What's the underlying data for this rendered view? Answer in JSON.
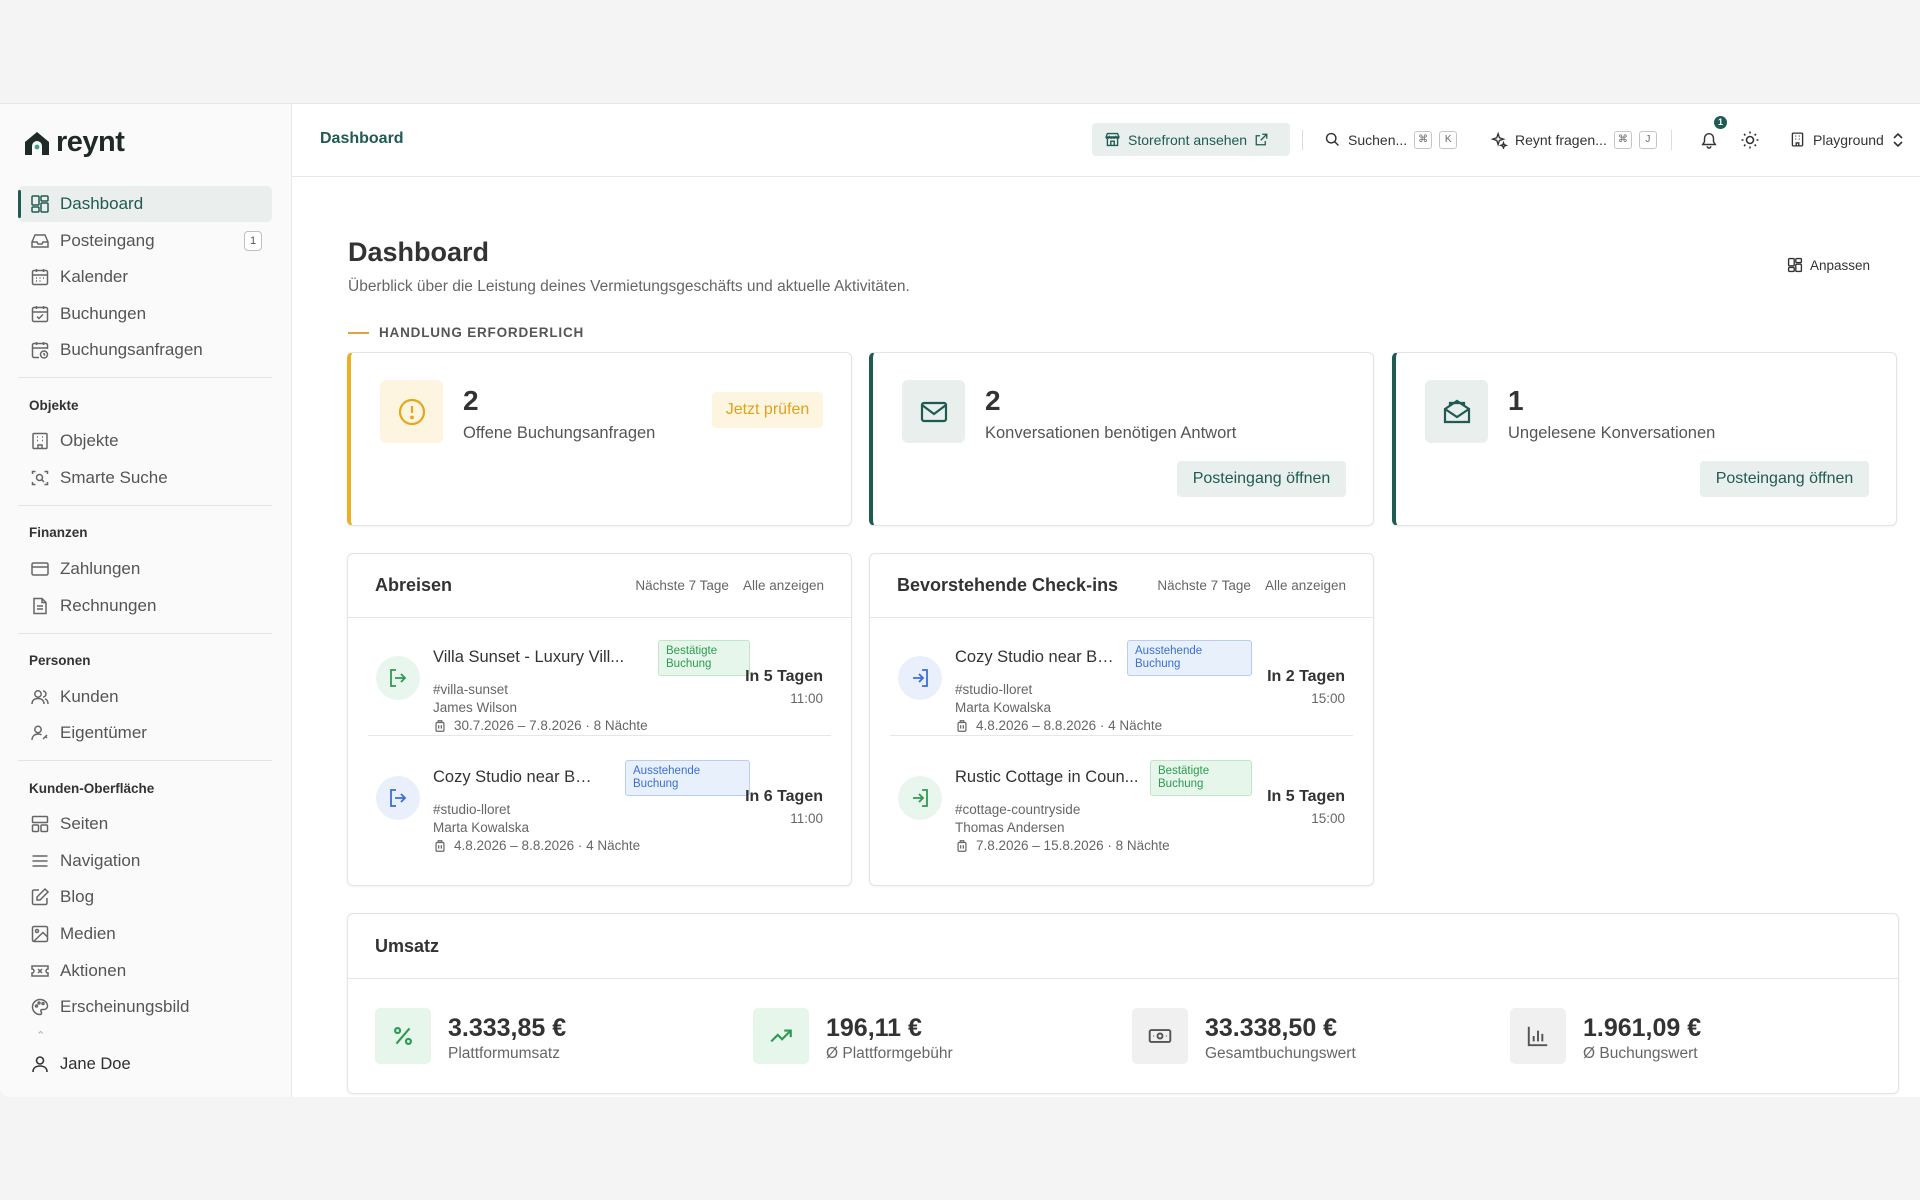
{
  "brand": {
    "name": "reynt",
    "accent": "#1f5b52"
  },
  "sidebar": {
    "items_top": [
      {
        "label": "Dashboard",
        "icon": "dashboard-icon",
        "active": true
      },
      {
        "label": "Posteingang",
        "icon": "inbox-icon",
        "badge": "1"
      },
      {
        "label": "Kalender",
        "icon": "calendar-icon"
      },
      {
        "label": "Buchungen",
        "icon": "calendar-check-icon"
      },
      {
        "label": "Buchungsanfragen",
        "icon": "calendar-clock-icon"
      }
    ],
    "sections": [
      {
        "title": "Objekte",
        "items": [
          {
            "label": "Objekte",
            "icon": "building-icon"
          },
          {
            "label": "Smarte Suche",
            "icon": "scan-search-icon"
          }
        ]
      },
      {
        "title": "Finanzen",
        "items": [
          {
            "label": "Zahlungen",
            "icon": "credit-card-icon"
          },
          {
            "label": "Rechnungen",
            "icon": "file-text-icon"
          }
        ]
      },
      {
        "title": "Personen",
        "items": [
          {
            "label": "Kunden",
            "icon": "users-icon"
          },
          {
            "label": "Eigentümer",
            "icon": "user-key-icon"
          }
        ]
      },
      {
        "title": "Kunden-Oberfläche",
        "items": [
          {
            "label": "Seiten",
            "icon": "layout-icon"
          },
          {
            "label": "Navigation",
            "icon": "menu-icon"
          },
          {
            "label": "Blog",
            "icon": "edit-icon"
          },
          {
            "label": "Medien",
            "icon": "image-icon"
          },
          {
            "label": "Aktionen",
            "icon": "ticket-icon"
          },
          {
            "label": "Erscheinungsbild",
            "icon": "palette-icon"
          }
        ]
      }
    ],
    "user": "Jane Doe"
  },
  "topbar": {
    "breadcrumb": "Dashboard",
    "storefront": "Storefront ansehen",
    "search": "Suchen...",
    "search_keys": [
      "⌘",
      "K"
    ],
    "ask": "Reynt fragen...",
    "ask_keys": [
      "⌘",
      "J"
    ],
    "notif_count": "1",
    "workspace": "Playground"
  },
  "page": {
    "title": "Dashboard",
    "subtitle": "Überblick über die Leistung deines Vermietungsgeschäfts und aktuelle Aktivitäten.",
    "customize": "Anpassen",
    "section_label": "HANDLUNG ERFORDERLICH"
  },
  "action_cards": [
    {
      "count": "2",
      "label": "Offene Buchungsanfragen",
      "button": "Jetzt prüfen"
    },
    {
      "count": "2",
      "label": "Konversationen benötigen Antwort",
      "button": "Posteingang öffnen"
    },
    {
      "count": "1",
      "label": "Ungelesene Konversationen",
      "button": "Posteingang öffnen"
    }
  ],
  "departures": {
    "title": "Abreisen",
    "range": "Nächste 7 Tage",
    "all": "Alle anzeigen",
    "rows": [
      {
        "name": "Villa Sunset - Luxury Vill...",
        "badge": [
          "Bestätigte",
          "Buchung"
        ],
        "slug": "#villa-sunset",
        "person": "James Wilson",
        "dates": "30.7.2026 – 7.8.2026 · 8 Nächte",
        "when": "In 5 Tagen",
        "time": "11:00"
      },
      {
        "name": "Cozy Studio near Be...",
        "badge": [
          "Ausstehende",
          "Buchung"
        ],
        "slug": "#studio-lloret",
        "person": "Marta Kowalska",
        "dates": "4.8.2026 – 8.8.2026 · 4 Nächte",
        "when": "In 6 Tagen",
        "time": "11:00"
      }
    ]
  },
  "checkins": {
    "title": "Bevorstehende Check-ins",
    "range": "Nächste 7 Tage",
    "all": "Alle anzeigen",
    "rows": [
      {
        "name": "Cozy Studio near Be...",
        "badge": [
          "Ausstehende",
          "Buchung"
        ],
        "slug": "#studio-lloret",
        "person": "Marta Kowalska",
        "dates": "4.8.2026 – 8.8.2026 · 4 Nächte",
        "when": "In 2 Tagen",
        "time": "15:00"
      },
      {
        "name": "Rustic Cottage in Coun...",
        "badge": [
          "Bestätigte",
          "Buchung"
        ],
        "slug": "#cottage-countryside",
        "person": "Thomas Andersen",
        "dates": "7.8.2026 – 15.8.2026 · 8 Nächte",
        "when": "In 5 Tagen",
        "time": "15:00"
      }
    ]
  },
  "revenue": {
    "title": "Umsatz",
    "stats": [
      {
        "value": "3.333,85 €",
        "label": "Plattformumsatz",
        "icon": "percent-icon"
      },
      {
        "value": "196,11 €",
        "label": "Ø Plattformgebühr",
        "icon": "trending-up-icon"
      },
      {
        "value": "33.338,50 €",
        "label": "Gesamtbuchungswert",
        "icon": "banknote-icon"
      },
      {
        "value": "1.961,09 €",
        "label": "Ø Buchungswert",
        "icon": "bar-chart-icon"
      }
    ]
  }
}
